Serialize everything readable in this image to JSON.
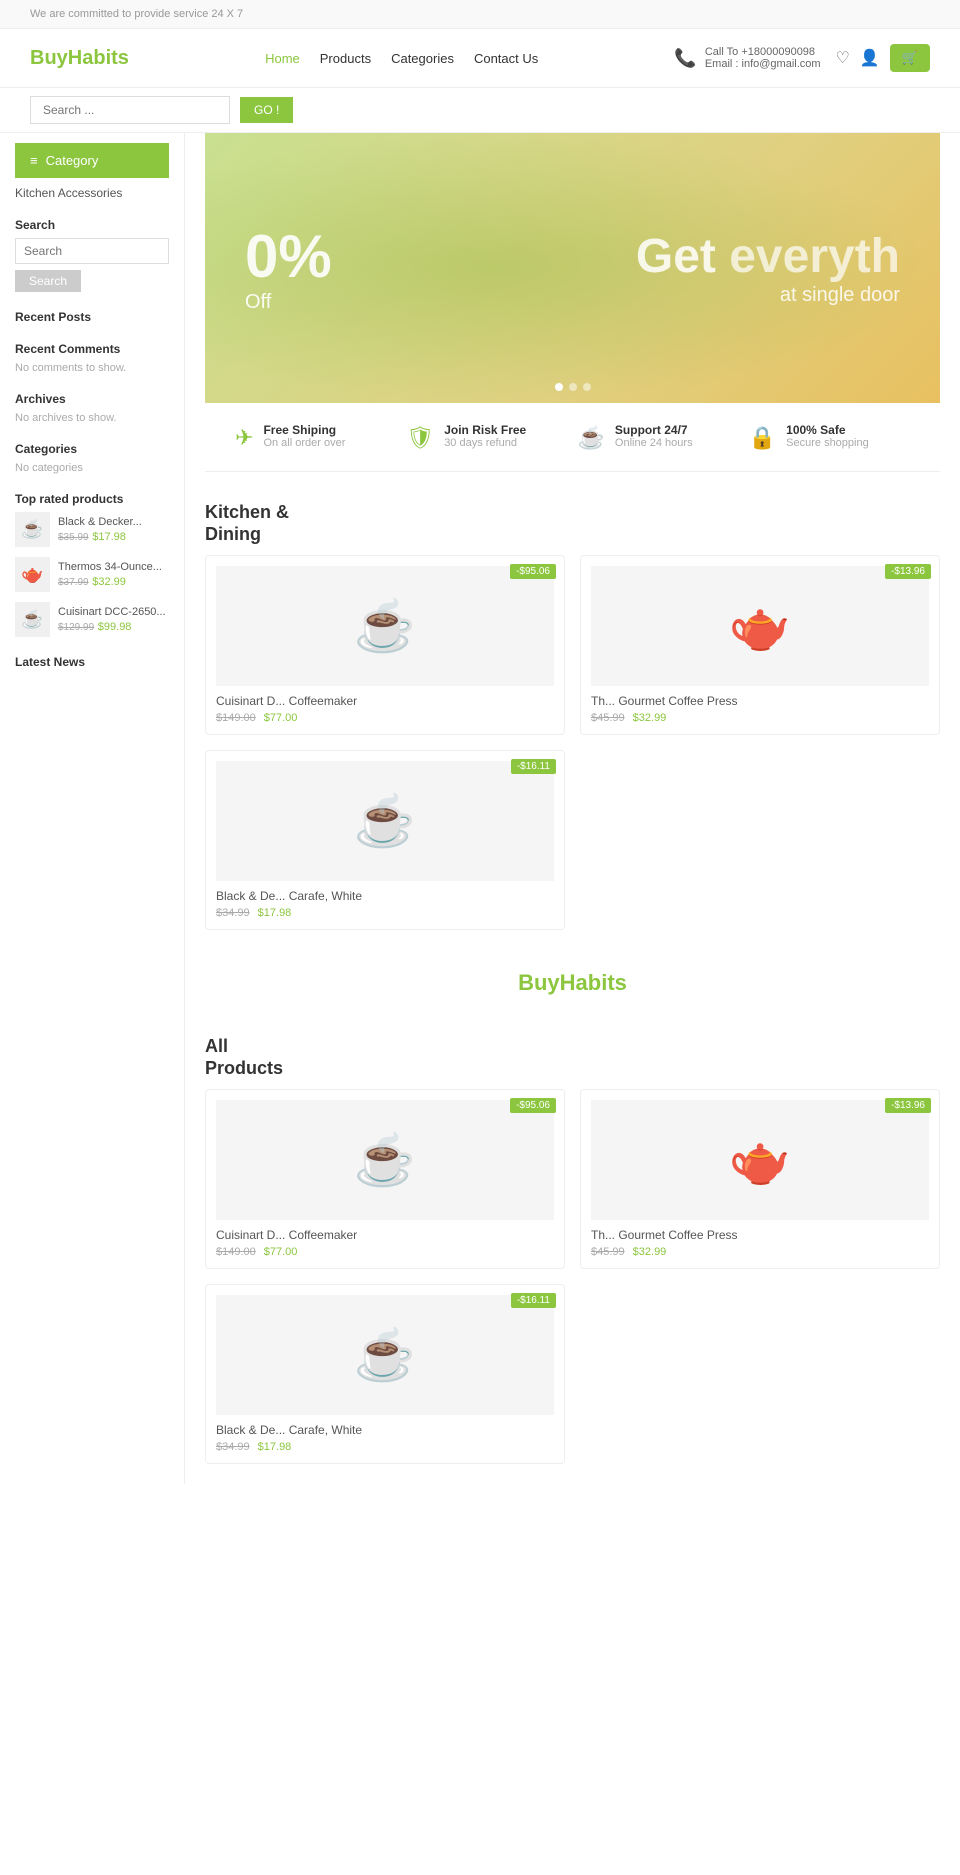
{
  "topbar": {
    "message": "We are committed to provide service 24 X 7"
  },
  "header": {
    "logo": {
      "buy": "Buy",
      "habits": "Habits"
    },
    "nav": [
      {
        "label": "Home",
        "active": true
      },
      {
        "label": "Products",
        "active": false
      },
      {
        "label": "Categories",
        "active": false
      },
      {
        "label": "Contact Us",
        "active": false
      }
    ],
    "contact": {
      "phone": "Call To +18000090098",
      "email": "Email : info@gmail.com"
    },
    "search_placeholder": "Search ...",
    "search_btn": "GO !"
  },
  "sidebar": {
    "category_btn": "Category",
    "links": [
      "Kitchen Accessories"
    ],
    "search_label": "Search",
    "search_placeholder": "Search",
    "search_btn": "Search",
    "recent_posts_label": "Recent Posts",
    "recent_comments_label": "Recent Comments",
    "recent_comments_empty": "No comments to show.",
    "archives_label": "Archives",
    "archives_empty": "No archives to show.",
    "categories_label": "Categories",
    "categories_empty": "No categories",
    "top_rated_label": "Top rated products",
    "top_rated": [
      {
        "name": "Black & Decker...",
        "price_old": "$35.99",
        "price_new": "$17.98",
        "icon": "☕"
      },
      {
        "name": "Thermos 34-Ounce...",
        "price_old": "$37.99",
        "price_new": "$32.99",
        "icon": "🫖"
      },
      {
        "name": "Cuisinart DCC-2650...",
        "price_old": "$129.99",
        "price_new": "$99.98",
        "icon": "☕"
      }
    ],
    "latest_news_label": "Latest News"
  },
  "hero": {
    "percent": "0%",
    "off": "Off",
    "get": "Get",
    "everything": "everyth",
    "single_door": "at single door"
  },
  "features": [
    {
      "icon": "✈",
      "title": "Free Shiping",
      "sub": "On all order over"
    },
    {
      "icon": "🛡",
      "title": "Join Risk Free",
      "sub": "30 days refund"
    },
    {
      "icon": "☕",
      "title": "Support 24/7",
      "sub": "Online 24 hours"
    },
    {
      "icon": "🔒",
      "title": "100% Safe",
      "sub": "Secure shopping"
    }
  ],
  "kitchen_section": {
    "heading_line1": "Kitchen &",
    "heading_line2": "Dining",
    "products": [
      {
        "name": "Cuisinart D... Coffeemaker",
        "price_old": "$149.00",
        "price_new": "$77.00",
        "badge": "-$95.06",
        "icon": "☕"
      },
      {
        "name": "Th... Gourmet Coffee Press",
        "price_old": "$45.99",
        "price_new": "$32.99",
        "badge": "-$13.96",
        "icon": "🫖"
      },
      {
        "name": "Black & De... Carafe, White",
        "price_old": "$34.99",
        "price_new": "$17.98",
        "badge": "-$16.11",
        "icon": "☕"
      }
    ]
  },
  "center_logo": {
    "buy": "Buy",
    "habits": "Habits"
  },
  "all_products_section": {
    "heading_line1": "All",
    "heading_line2": "Products",
    "products": [
      {
        "name": "Cuisinart D... Coffeemaker",
        "price_old": "$149.00",
        "price_new": "$77.00",
        "badge": "-$95.06",
        "icon": "☕"
      },
      {
        "name": "Th... Gourmet Coffee Press",
        "price_old": "$45.99",
        "price_new": "$32.99",
        "badge": "-$13.96",
        "icon": "🫖"
      },
      {
        "name": "Black & De... Carafe, White",
        "price_old": "$34.99",
        "price_new": "$17.98",
        "badge": "-$16.11",
        "icon": "☕"
      }
    ]
  }
}
